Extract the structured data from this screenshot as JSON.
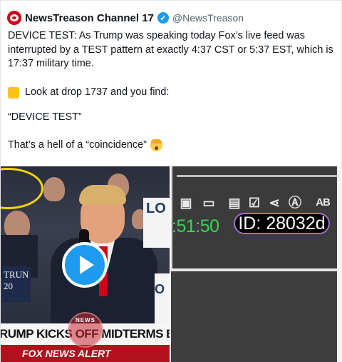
{
  "tweet": {
    "display_name": "NewsTreason Channel 17",
    "handle": "@NewsTreason",
    "paragraph1": "DEVICE TEST: As Trump was speaking today Fox’s live feed was interrupted by a TEST pattern at exactly 4:37 CST or 5:37 EST, which is 17:37 military time.",
    "paragraph2": "Look at drop 1737 and you find:",
    "paragraph3": "“DEVICE TEST”",
    "paragraph4": "That’s a hell of a “coincidence”"
  },
  "video": {
    "chyron": "RUMP KICKS OFF MIDTERMS BLITZ IN IOW",
    "ticker": "FOX NEWS ALERT",
    "sign_trump": "TRUN",
    "sign_year": "20",
    "sign_right": "LO",
    "sign_o": "O",
    "news_logo": "NEWS"
  },
  "test_panel": {
    "time_text": ":51:50",
    "id_text": "ID: 28032d",
    "tool_ab": "AB"
  },
  "colors": {
    "verified": "#1d9bf0",
    "play_button": "#1d9bf0",
    "time_green": "#39d353",
    "id_border": "#a56bd1"
  },
  "icons": [
    "verified-badge-icon",
    "yellow-square-icon",
    "shocked-face-emoji-icon",
    "play-icon",
    "image-icon",
    "vr-headset-icon",
    "clipboard-icon",
    "checklist-icon",
    "share-icon",
    "font-a-icon",
    "spellcheck-icon"
  ]
}
